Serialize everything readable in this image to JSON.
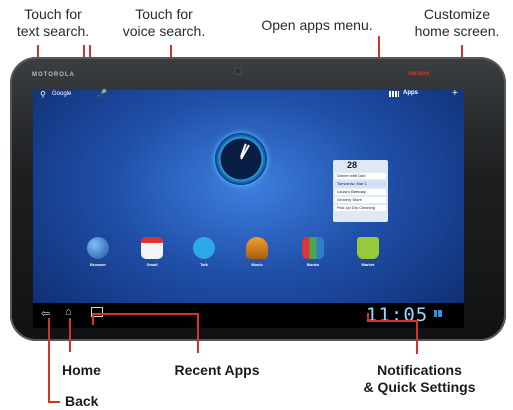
{
  "callouts": {
    "text_search": "Touch for\ntext search.",
    "voice_search": "Touch for\nvoice search.",
    "apps_menu": "Open apps menu.",
    "customize": "Customize\nhome screen.",
    "home": "Home",
    "recent_apps": "Recent Apps",
    "notifications": "Notifications\n& Quick Settings",
    "back": "Back"
  },
  "device": {
    "brand": "MOTOROLA",
    "carrier": "verizon"
  },
  "topbar": {
    "search_label": "Google",
    "apps_label": "Apps"
  },
  "calendar": {
    "date": "28",
    "events": [
      "Dinner with Dad",
      "Tomorrow, Mar 1",
      "Laura's Birthday",
      "Grocery Store",
      "Pick Up Dry Cleaning"
    ]
  },
  "apps": [
    {
      "label": "Browser",
      "icon": "globe-icon",
      "color": "#3a6fb0"
    },
    {
      "label": "Gmail",
      "icon": "gmail-icon",
      "color": "#f2f2f2"
    },
    {
      "label": "Talk",
      "icon": "talk-icon",
      "color": "#2fa8e8"
    },
    {
      "label": "Music",
      "icon": "headphones-icon",
      "color": "#e08a1e"
    },
    {
      "label": "Books",
      "icon": "books-icon",
      "color": "#4aa84a"
    },
    {
      "label": "Market",
      "icon": "market-icon",
      "color": "#97c93c"
    }
  ],
  "status": {
    "time": "11:05"
  },
  "colors": {
    "leader": "#d5332a",
    "wallpaper": "#1f4fa8"
  }
}
